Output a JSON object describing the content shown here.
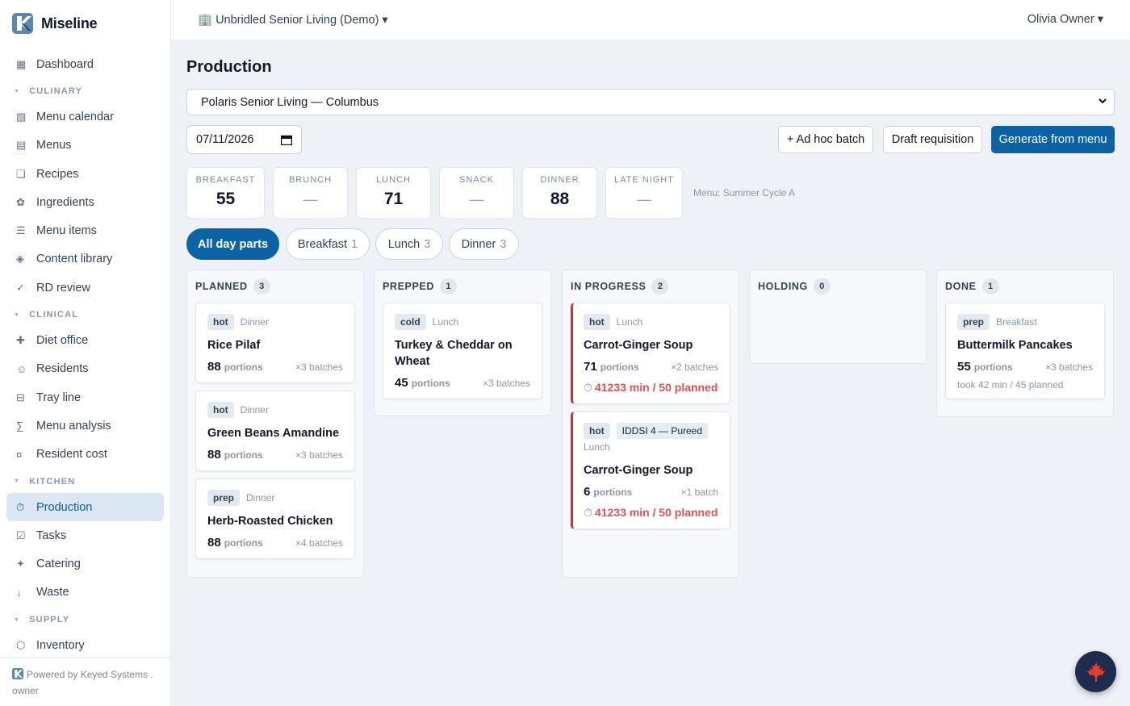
{
  "brand": {
    "name": "Miseline"
  },
  "sidebar": {
    "top_items": [
      {
        "icon": "dashboard-icon",
        "glyph": "▦",
        "label": "Dashboard"
      }
    ],
    "sections": [
      {
        "title": "CULINARY",
        "items": [
          {
            "glyph": "▧",
            "label": "Menu calendar"
          },
          {
            "glyph": "▤",
            "label": "Menus"
          },
          {
            "glyph": "❏",
            "label": "Recipes"
          },
          {
            "glyph": "✿",
            "label": "Ingredients"
          },
          {
            "glyph": "☰",
            "label": "Menu items"
          },
          {
            "glyph": "◈",
            "label": "Content library"
          },
          {
            "glyph": "✓",
            "label": "RD review"
          }
        ]
      },
      {
        "title": "CLINICAL",
        "items": [
          {
            "glyph": "✚",
            "label": "Diet office"
          },
          {
            "glyph": "☺",
            "label": "Residents"
          },
          {
            "glyph": "⊟",
            "label": "Tray line"
          },
          {
            "glyph": "∑",
            "label": "Menu analysis"
          },
          {
            "glyph": "¤",
            "label": "Resident cost"
          }
        ]
      },
      {
        "title": "KITCHEN",
        "items": [
          {
            "glyph": "⏱",
            "label": "Production",
            "active": true
          },
          {
            "glyph": "☑",
            "label": "Tasks"
          },
          {
            "glyph": "✦",
            "label": "Catering"
          },
          {
            "glyph": "↓",
            "label": "Waste"
          }
        ]
      },
      {
        "title": "SUPPLY",
        "items": [
          {
            "glyph": "⬡",
            "label": "Inventory"
          }
        ]
      }
    ],
    "footer": {
      "powered": "Powered by Keyed Systems .",
      "role": "owner"
    }
  },
  "topbar": {
    "org": "🏢 Unbridled Senior Living (Demo) ▾",
    "user": "Olivia Owner ▾"
  },
  "page": {
    "title": "Production",
    "location": "Polaris Senior Living — Columbus",
    "date": "07/11/2026",
    "actions": {
      "adhoc": "+ Ad hoc batch",
      "draft": "Draft requisition",
      "generate": "Generate from menu"
    },
    "menu_note": "Menu: Summer Cycle A"
  },
  "stats": [
    {
      "label": "BREAKFAST",
      "value": "55"
    },
    {
      "label": "BRUNCH",
      "value": "—"
    },
    {
      "label": "LUNCH",
      "value": "71"
    },
    {
      "label": "SNACK",
      "value": "—"
    },
    {
      "label": "DINNER",
      "value": "88"
    },
    {
      "label": "LATE NIGHT",
      "value": "—"
    }
  ],
  "filters": [
    {
      "label": "All day parts",
      "count": "",
      "active": true
    },
    {
      "label": "Breakfast",
      "count": "1"
    },
    {
      "label": "Lunch",
      "count": "3"
    },
    {
      "label": "Dinner",
      "count": "3"
    }
  ],
  "columns": [
    {
      "title": "PLANNED",
      "count": "3",
      "cards": [
        {
          "tags": [
            "hot"
          ],
          "daypart": "Dinner",
          "name": "Rice Pilaf",
          "portions": "88",
          "portions_label": "portions",
          "batches": "×3 batches"
        },
        {
          "tags": [
            "hot"
          ],
          "daypart": "Dinner",
          "name": "Green Beans Amandine",
          "portions": "88",
          "portions_label": "portions",
          "batches": "×3 batches"
        },
        {
          "tags": [
            "prep"
          ],
          "daypart": "Dinner",
          "name": "Herb-Roasted Chicken",
          "portions": "88",
          "portions_label": "portions",
          "batches": "×4 batches"
        }
      ]
    },
    {
      "title": "PREPPED",
      "count": "1",
      "cards": [
        {
          "tags": [
            "cold"
          ],
          "daypart": "Lunch",
          "name": "Turkey & Cheddar on Wheat",
          "portions": "45",
          "portions_label": "portions",
          "batches": "×3 batches"
        }
      ]
    },
    {
      "title": "IN PROGRESS",
      "count": "2",
      "cards": [
        {
          "tags": [
            "hot"
          ],
          "daypart": "Lunch",
          "name": "Carrot-Ginger Soup",
          "portions": "71",
          "portions_label": "portions",
          "batches": "×2 batches",
          "timer": "41233 min / 50 planned",
          "alert": true
        },
        {
          "tags": [
            "hot"
          ],
          "diet": "IDDSI 4 — Pureed",
          "daypart": "Lunch",
          "name": "Carrot-Ginger Soup",
          "portions": "6",
          "portions_label": "portions",
          "batches": "×1 batch",
          "timer": "41233 min / 50 planned",
          "alert": true
        }
      ]
    },
    {
      "title": "HOLDING",
      "count": "0",
      "cards": []
    },
    {
      "title": "DONE",
      "count": "1",
      "cards": [
        {
          "tags": [
            "prep"
          ],
          "daypart": "Breakfast",
          "name": "Buttermilk Pancakes",
          "portions": "55",
          "portions_label": "portions",
          "batches": "×3 batches",
          "note": "took 42 min / 45 planned"
        }
      ]
    }
  ],
  "fab": {
    "icon": "maple-leaf-icon",
    "glyph": "🍁"
  }
}
